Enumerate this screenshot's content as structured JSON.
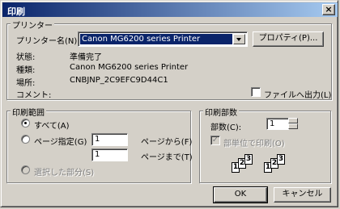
{
  "window": {
    "title": "印刷",
    "close_label": "×"
  },
  "printer": {
    "group_label": "プリンター",
    "name_label": "プリンター名(N):",
    "selected_printer": "Canon MG6200 series Printer",
    "properties_button": "プロパティ(P)...",
    "status_label": "状態:",
    "status_value": "準備完了",
    "type_label": "種類:",
    "type_value": "Canon MG6200 series Printer",
    "location_label": "場所:",
    "location_value": "CNBJNP_2C9EFC9D44C1",
    "comment_label": "コメント:",
    "print_to_file_label": "ファイルへ出力(L)",
    "print_to_file_checked": false
  },
  "print_range": {
    "group_label": "印刷範囲",
    "all_label": "すべて(A)",
    "pages_label": "ページ指定(G)",
    "from_value": "1",
    "from_suffix": "ページから(F)",
    "to_value": "1",
    "to_suffix": "ページまで(T)",
    "selection_label": "選択した部分(S)",
    "selected_option": "all"
  },
  "copies": {
    "group_label": "印刷部数",
    "count_label": "部数(C):",
    "count_value": "1",
    "collate_label": "部単位で印刷(O)",
    "collate_checked": true,
    "collate_icon": "collate-pages-icon",
    "page_numbers": [
      "1",
      "2",
      "3"
    ]
  },
  "buttons": {
    "ok": "OK",
    "cancel": "キャンセル"
  }
}
